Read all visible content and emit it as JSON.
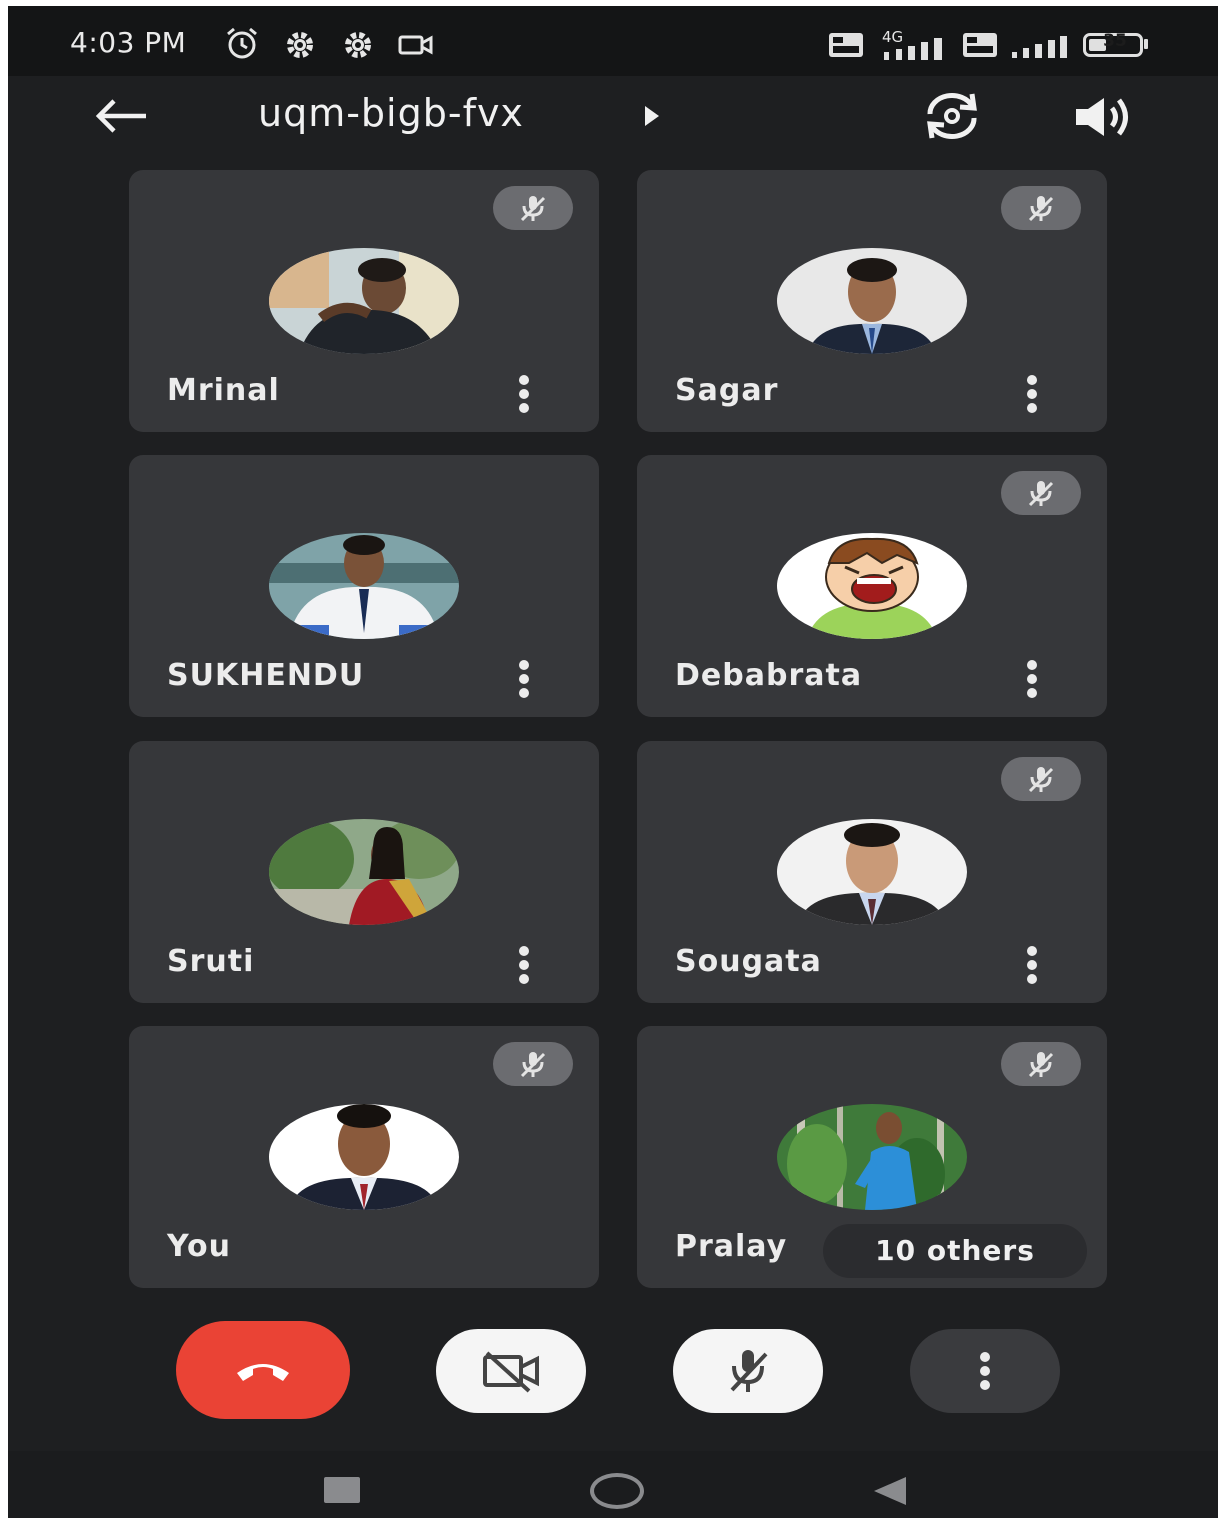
{
  "status_bar": {
    "time": "4:03 PM",
    "network": "4G",
    "battery": "35",
    "icons": [
      "alarm-icon",
      "settings-icon",
      "settings-icon",
      "camera-icon",
      "volte-icon",
      "signal-icon",
      "volte-icon",
      "signal-icon",
      "battery-icon"
    ]
  },
  "top_bar": {
    "meeting_code": "uqm-bigb-fvx",
    "icons": [
      "back-arrow-icon",
      "play-arrow-icon",
      "switch-camera-icon",
      "speaker-icon"
    ]
  },
  "participants": [
    {
      "name": "Mrinal",
      "muted": true,
      "has_menu": true
    },
    {
      "name": "Sagar",
      "muted": true,
      "has_menu": true
    },
    {
      "name": "SUKHENDU",
      "muted": false,
      "has_menu": true
    },
    {
      "name": "Debabrata",
      "muted": true,
      "has_menu": true
    },
    {
      "name": "Sruti",
      "muted": false,
      "has_menu": true
    },
    {
      "name": "Sougata",
      "muted": true,
      "has_menu": true
    },
    {
      "name": "You",
      "muted": true,
      "has_menu": false
    },
    {
      "name": "Pralay",
      "muted": true,
      "has_menu": false
    }
  ],
  "others_chip": "10 others",
  "controls": [
    "end-call-icon",
    "camera-off-icon",
    "mic-off-icon",
    "more-vert-icon"
  ],
  "nav_bar": [
    "recents-icon",
    "home-icon",
    "back-triangle-icon"
  ],
  "colors": {
    "background": "#1e1f21",
    "tile": "#36373a",
    "mute_badge": "#6b6c70",
    "end_call": "#ea4335",
    "control_light": "#f5f5f5",
    "control_dark": "#3a3b3e"
  }
}
